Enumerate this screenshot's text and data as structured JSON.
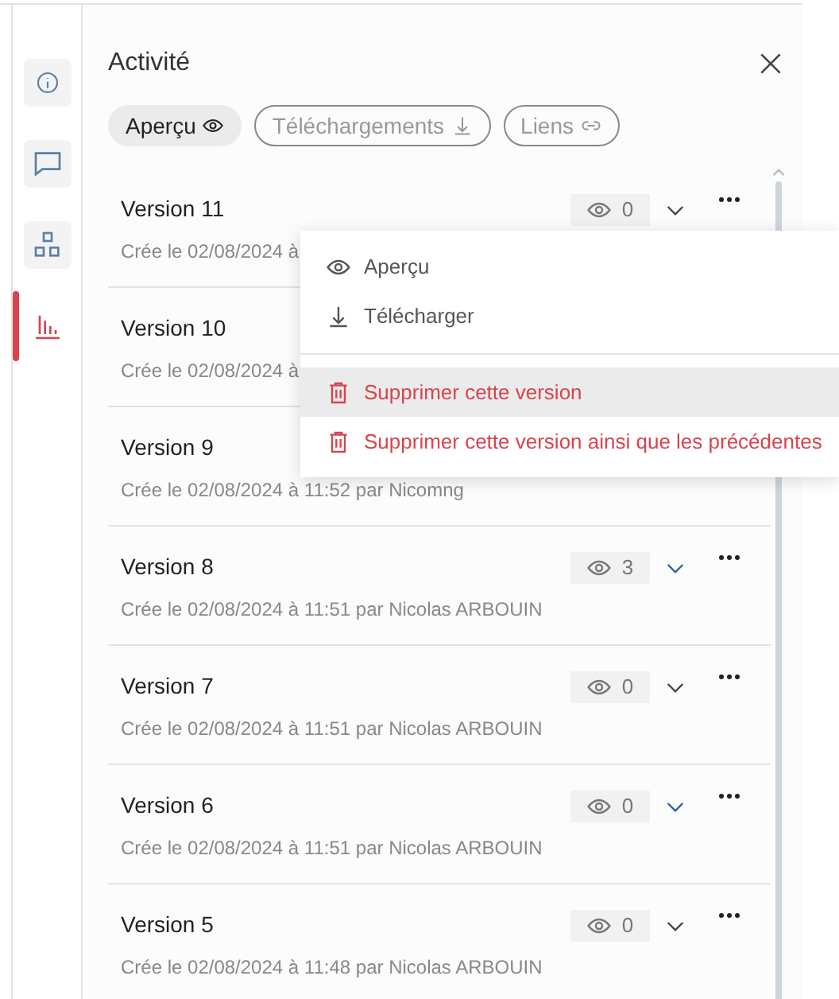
{
  "sidebar": {
    "items": [
      {
        "kind": "info",
        "selected": false
      },
      {
        "kind": "comment",
        "selected": false
      },
      {
        "kind": "grid",
        "selected": false
      },
      {
        "kind": "chart",
        "selected": true
      }
    ]
  },
  "panel": {
    "title": "Activité"
  },
  "filters": [
    {
      "label": "Aperçu",
      "selected": true
    },
    {
      "label": "Téléchargements",
      "selected": false
    },
    {
      "label": "Liens",
      "selected": false
    }
  ],
  "versions": [
    {
      "title": "Version 11",
      "meta": "Crée le 02/08/2024 à",
      "views": "0",
      "chevron_highlighted": false
    },
    {
      "title": "Version 10",
      "meta": "Crée le 02/08/2024 à"
    },
    {
      "title": "Version 9",
      "meta": "Crée le 02/08/2024 à 11:52 par Nicomng"
    },
    {
      "title": "Version 8",
      "meta": "Crée le 02/08/2024 à 11:51 par Nicolas ARBOUIN",
      "views": "3",
      "chevron_highlighted": true
    },
    {
      "title": "Version 7",
      "meta": "Crée le 02/08/2024 à 11:51 par Nicolas ARBOUIN",
      "views": "0",
      "chevron_highlighted": false
    },
    {
      "title": "Version 6",
      "meta": "Crée le 02/08/2024 à 11:51 par Nicolas ARBOUIN",
      "views": "0",
      "chevron_highlighted": true
    },
    {
      "title": "Version 5",
      "meta": "Crée le 02/08/2024 à 11:48 par Nicolas ARBOUIN",
      "views": "0",
      "chevron_highlighted": false
    }
  ],
  "context_menu": {
    "items": [
      {
        "label": "Aperçu",
        "kind": "preview",
        "danger": false,
        "selected": false
      },
      {
        "label": "Télécharger",
        "kind": "download",
        "danger": false,
        "selected": false
      },
      {
        "kind": "divider"
      },
      {
        "label": "Supprimer cette version",
        "kind": "delete",
        "danger": true,
        "selected": true
      },
      {
        "label": "Supprimer cette version ainsi que les précédentes",
        "kind": "delete",
        "danger": true,
        "selected": false
      }
    ]
  }
}
